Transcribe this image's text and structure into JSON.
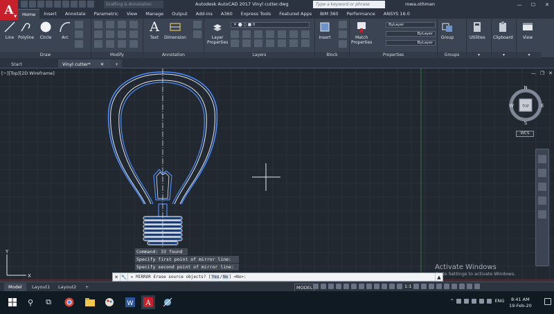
{
  "title_bar": {
    "app_logo_letter": "A",
    "workspace": "Drafting & Annotation",
    "title": "Autodesk AutoCAD 2017    Vinyl cutter.dwg",
    "search_placeholder": "Type a keyword or phrase",
    "user": "rowa.othman"
  },
  "ribbon_tabs": [
    "Home",
    "Insert",
    "Annotate",
    "Parametric",
    "View",
    "Manage",
    "Output",
    "Add-ins",
    "A360",
    "Express Tools",
    "Featured Apps",
    "BIM 360",
    "Performance",
    "ANSYS 16.0"
  ],
  "active_tab": "Home",
  "ribbon": {
    "draw": {
      "label": "Draw",
      "buttons": [
        "Line",
        "Polyline",
        "Circle",
        "Arc"
      ]
    },
    "modify": {
      "label": "Modify"
    },
    "annotation": {
      "label": "Annotation",
      "buttons": [
        "Text",
        "Dimension"
      ]
    },
    "layers": {
      "label": "Layers",
      "button": "Layer\nProperties",
      "layer_value": "0"
    },
    "block": {
      "label": "Block",
      "button": "Insert"
    },
    "properties": {
      "label": "Properties",
      "button": "Match\nProperties",
      "color": "ByLayer",
      "linetype": "ByLayer",
      "lineweight": "ByLayer"
    },
    "groups": {
      "label": "Groups",
      "button": "Group"
    },
    "utilities": {
      "button": "Utilities"
    },
    "clipboard": {
      "button": "Clipboard"
    },
    "view": {
      "button": "View"
    }
  },
  "file_tabs": {
    "start": "Start",
    "current": "Vinyl cutter*",
    "add": "+"
  },
  "viewport": {
    "label": "[−][Top][2D Wireframe]",
    "viewcube": {
      "n": "N",
      "s": "S",
      "e": "E",
      "w": "W",
      "top": "TOP"
    },
    "wcs": "WCS",
    "ucs_x": "X",
    "ucs_y": "Y"
  },
  "command_history": [
    "Command: 33 found",
    "Specify first point of mirror line:",
    "Specify second point of mirror line:"
  ],
  "command_line": {
    "prefix": "MIRROR Erase source objects? [",
    "opt_yes": "Yes",
    "opt_no": "No",
    "suffix": "] <No>:"
  },
  "watermark": {
    "line1": "Activate Windows",
    "line2": "Go to Settings to activate Windows."
  },
  "layout_tabs": [
    "Model",
    "Layout1",
    "Layout2",
    "+"
  ],
  "status": {
    "model": "MODEL",
    "scale": "1:1"
  },
  "taskbar": {
    "lang": "ENG",
    "time": "8:41 AM",
    "date": "19-Feb-20"
  },
  "colors": {
    "accent": "#c8202a",
    "bulb_inner": "#4b8cff",
    "bulb_outer": "#e6ebf3",
    "grid": "#2a323c",
    "y_axis": "#2e7d32",
    "x_axis": "#8b2b2b"
  }
}
